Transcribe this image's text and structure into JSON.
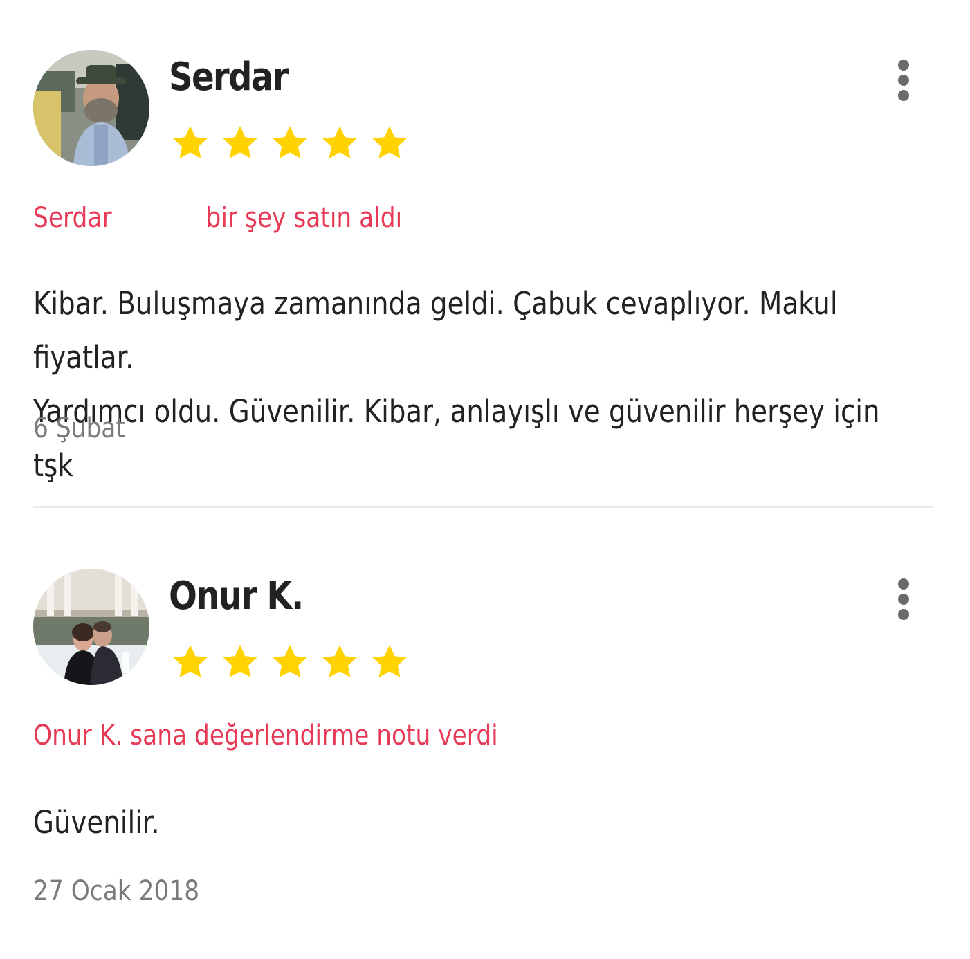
{
  "reviews": [
    {
      "reviewer_name": "Serdar",
      "rating": 5,
      "action_name": "Serdar",
      "action_text": "bir şey satın aldı",
      "text_line_1": "Kibar. Buluşmaya zamanında geldi. Çabuk cevaplıyor. Makul fiyatlar.",
      "text_line_2": "Yardımcı oldu. Güvenilir. Kibar, anlayışlı ve güvenilir herşey için tşk",
      "date": "6 Şubat"
    },
    {
      "reviewer_name": "Onur K.",
      "rating": 5,
      "action_text": "Onur K. sana değerlendirme notu verdi",
      "text_line_1": "Güvenilir.",
      "date": "27 Ocak 2018"
    }
  ],
  "colors": {
    "star": "#FFD200",
    "accent": "#E63A56",
    "text": "#222222",
    "muted": "#7A7A7A",
    "divider": "#E9E9E9"
  },
  "icons": {
    "star": "star-icon",
    "more": "more-vertical-icon"
  }
}
